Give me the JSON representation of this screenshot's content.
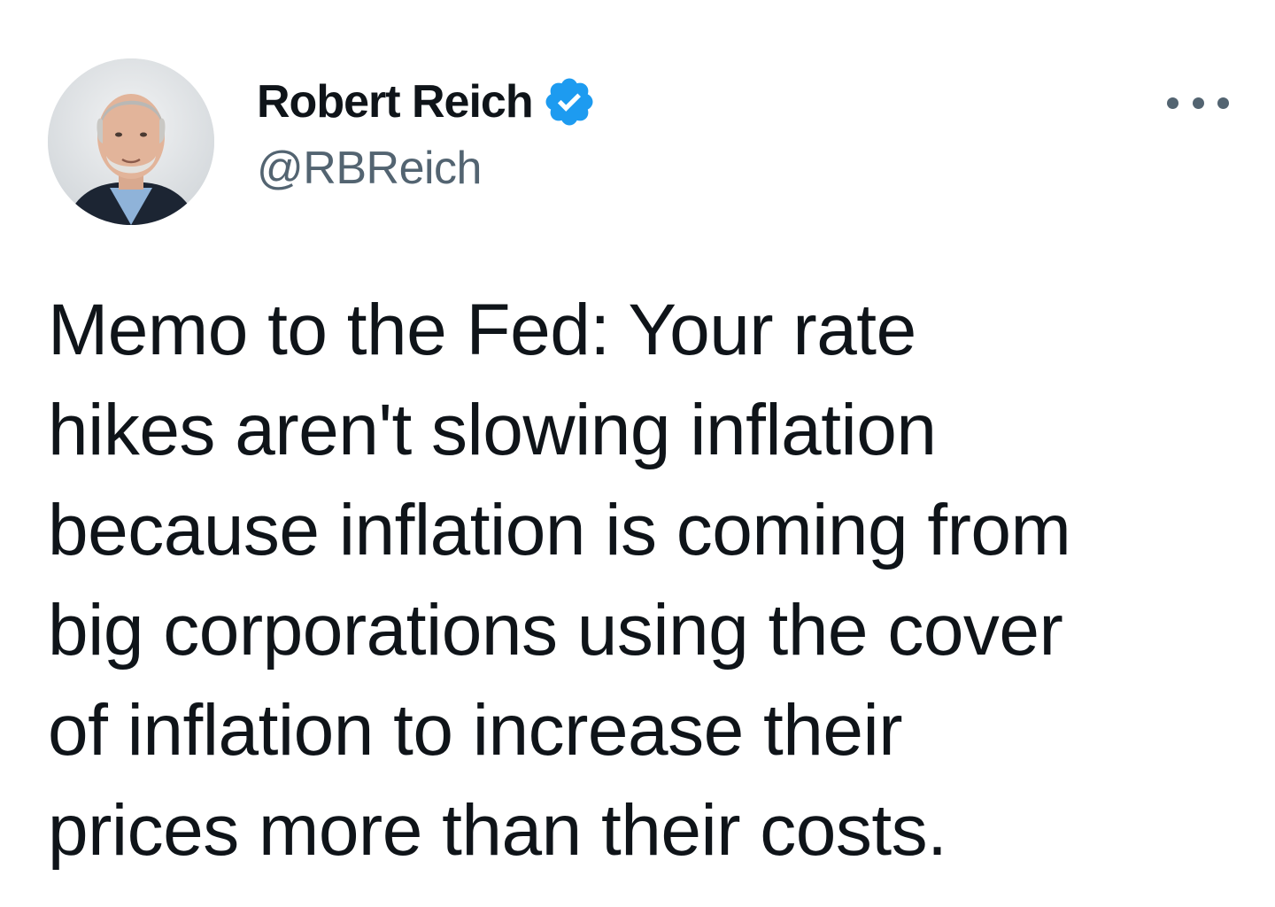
{
  "author": {
    "display_name": "Robert Reich",
    "handle": "@RBReich",
    "verified": true,
    "avatar_icon": "profile-photo"
  },
  "tweet": {
    "lines": [
      "Memo to the Fed: Your rate",
      "hikes aren't slowing inflation",
      "because inflation is coming from",
      "big corporations using the cover",
      "of inflation to increase their",
      "prices more than their costs."
    ]
  },
  "icons": {
    "verified": "verified-badge-icon",
    "more": "more-options-icon"
  },
  "colors": {
    "text_primary": "#0f1419",
    "text_secondary": "#536471",
    "verified_blue": "#1d9bf0",
    "background": "#ffffff"
  }
}
